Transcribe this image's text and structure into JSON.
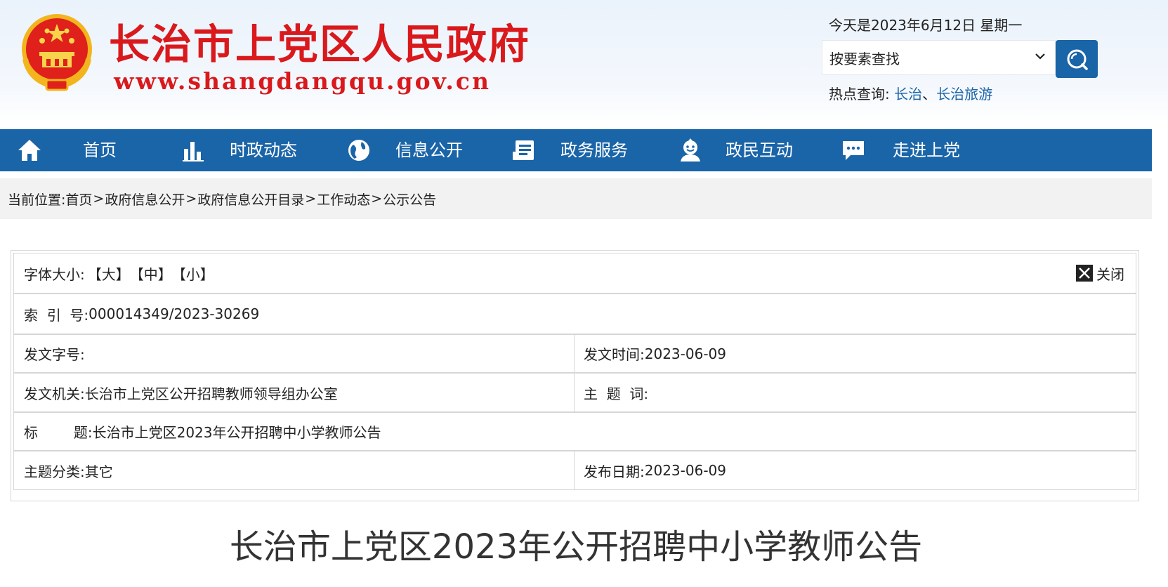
{
  "header": {
    "site_name": "长治市上党区人民政府",
    "site_url": "www.shangdangqu.gov.cn",
    "date_text": "今天是2023年6月12日 星期一",
    "search_select": "按要素查找",
    "hot_label": "热点查询:",
    "hot_links": [
      "长治",
      "长治旅游"
    ],
    "hot_sep": "、"
  },
  "nav": {
    "items": [
      {
        "label": "首页",
        "icon": "home-icon"
      },
      {
        "label": "时政动态",
        "icon": "bar-chart-icon"
      },
      {
        "label": "信息公开",
        "icon": "globe-icon"
      },
      {
        "label": "政务服务",
        "icon": "document-icon"
      },
      {
        "label": "政民互动",
        "icon": "people-icon"
      },
      {
        "label": "走进上党",
        "icon": "chat-bubble-icon"
      }
    ]
  },
  "breadcrumb": {
    "prefix": "当前位置:",
    "items": [
      "首页",
      "政府信息公开",
      "政府信息公开目录",
      "工作动态",
      "公示公告"
    ],
    "sep": ">"
  },
  "info": {
    "font_size_label": "字体大小:",
    "font_options": [
      "【大】",
      "【中】",
      "【小】"
    ],
    "close_label": "关闭",
    "index_label": "索  引  号:",
    "index_value": "000014349/2023-30269",
    "doc_no_label": "发文字号:",
    "doc_no_value": "",
    "issue_time_label": "发文时间:",
    "issue_time_value": "2023-06-09",
    "issuer_label": "发文机关:",
    "issuer_value": "长治市上党区公开招聘教师领导组办公室",
    "keywords_label": "主  题  词:",
    "keywords_value": "",
    "title_label": "标        题:",
    "title_value": "长治市上党区2023年公开招聘中小学教师公告",
    "category_label": "主题分类:",
    "category_value": "其它",
    "publish_label": "发布日期:",
    "publish_value": "2023-06-09"
  },
  "article": {
    "title": "长治市上党区2023年公开招聘中小学教师公告"
  },
  "colors": {
    "brand_red": "#d9191c",
    "nav_blue": "#1a64a8",
    "link_blue": "#1a64a8"
  }
}
